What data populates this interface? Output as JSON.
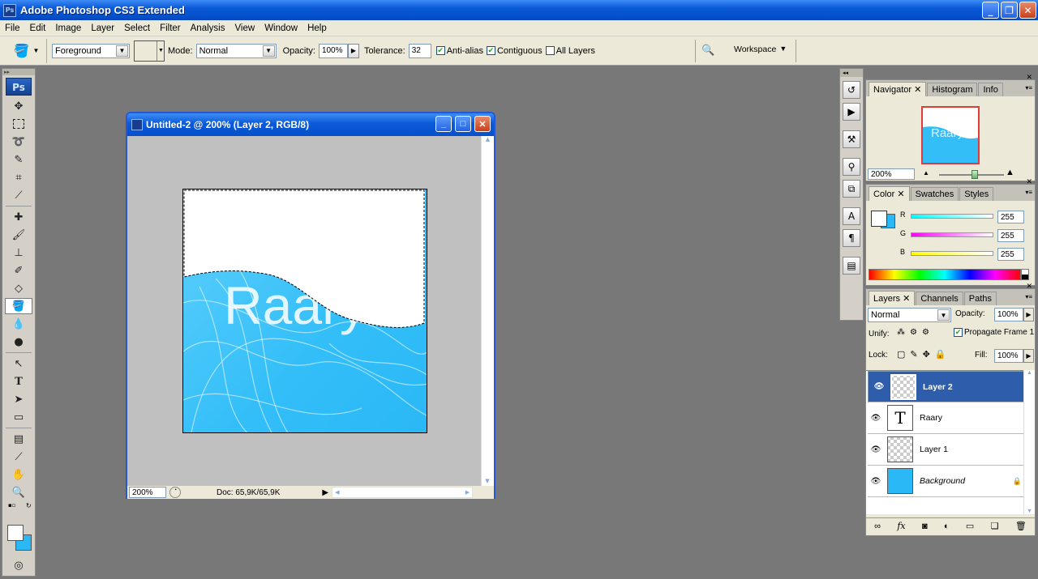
{
  "window": {
    "title": "Adobe Photoshop CS3 Extended",
    "app_icon": "Ps"
  },
  "menu": [
    "File",
    "Edit",
    "Image",
    "Layer",
    "Select",
    "Filter",
    "Analysis",
    "View",
    "Window",
    "Help"
  ],
  "options": {
    "fill_source": "Foreground",
    "mode_label": "Mode:",
    "mode_value": "Normal",
    "opacity_label": "Opacity:",
    "opacity_value": "100%",
    "tolerance_label": "Tolerance:",
    "tolerance_value": "32",
    "anti_alias": "Anti-alias",
    "contiguous": "Contiguous",
    "all_layers": "All Layers",
    "workspace": "Workspace"
  },
  "toolbox": {
    "logo": "Ps"
  },
  "document": {
    "title": "Untitled-2 @ 200% (Layer 2, RGB/8)",
    "zoom": "200%",
    "doc_info": "Doc: 65,9K/65,9K",
    "canvas_text": "Raary"
  },
  "navigator": {
    "tabs": [
      "Navigator",
      "Histogram",
      "Info"
    ],
    "zoom": "200%"
  },
  "color": {
    "tabs": [
      "Color",
      "Swatches",
      "Styles"
    ],
    "r_label": "R",
    "r_value": "255",
    "g_label": "G",
    "g_value": "255",
    "b_label": "B",
    "b_value": "255",
    "foreground": "#ffffff",
    "background": "#2ab8f6"
  },
  "layers": {
    "tabs": [
      "Layers",
      "Channels",
      "Paths"
    ],
    "blend_mode": "Normal",
    "opacity_label": "Opacity:",
    "opacity_value": "100%",
    "unify_label": "Unify:",
    "propagate_label": "Propagate Frame 1",
    "lock_label": "Lock:",
    "fill_label": "Fill:",
    "fill_value": "100%",
    "items": [
      {
        "name": "Layer 2",
        "selected": true
      },
      {
        "name": "Raary",
        "selected": false
      },
      {
        "name": "Layer 1",
        "selected": false
      },
      {
        "name": "Background",
        "selected": false
      }
    ]
  }
}
